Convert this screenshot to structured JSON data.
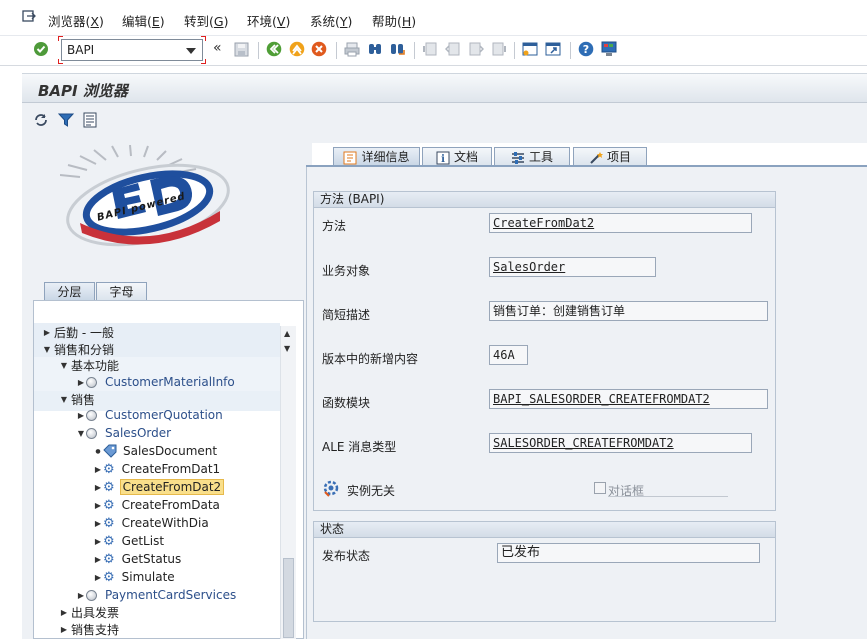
{
  "menu": {
    "items": [
      {
        "text": "浏览器(",
        "key": "X",
        "end": ")"
      },
      {
        "text": "编辑(",
        "key": "E",
        "end": ")"
      },
      {
        "text": "转到(",
        "key": "G",
        "end": ")"
      },
      {
        "text": "环境(",
        "key": "V",
        "end": ")"
      },
      {
        "text": "系统(",
        "key": "Y",
        "end": ")"
      },
      {
        "text": "帮助(",
        "key": "H",
        "end": ")"
      }
    ]
  },
  "toolbar": {
    "command_value": "BAPI",
    "collapse_symbol": "«"
  },
  "page": {
    "title": "BAPI 浏览器"
  },
  "logo": {
    "caption": "BAPI powered"
  },
  "left_tabs": [
    "分层",
    "字母"
  ],
  "tree": {
    "rows": [
      {
        "label": "后勤 - 一般"
      },
      {
        "label": "销售和分销"
      },
      {
        "label": "基本功能"
      },
      {
        "label": "CustomerMaterialInfo"
      },
      {
        "label": "销售"
      },
      {
        "label": "CustomerQuotation"
      },
      {
        "label": "SalesOrder"
      },
      {
        "label": "SalesDocument"
      },
      {
        "label": "CreateFromDat1"
      },
      {
        "label": "CreateFromDat2"
      },
      {
        "label": "CreateFromData"
      },
      {
        "label": "CreateWithDia"
      },
      {
        "label": "GetList"
      },
      {
        "label": "GetStatus"
      },
      {
        "label": "Simulate"
      },
      {
        "label": "PaymentCardServices"
      },
      {
        "label": "出具发票"
      },
      {
        "label": "销售支持"
      }
    ],
    "selected": "CreateFromDat2"
  },
  "right_tabs": [
    {
      "label": "详细信息",
      "icon": "detail-icon"
    },
    {
      "label": "文档",
      "icon": "info-icon"
    },
    {
      "label": "工具",
      "icon": "tools-icon"
    },
    {
      "label": "项目",
      "icon": "project-wand-icon"
    }
  ],
  "method_group": {
    "title": "方法 (BAPI)",
    "fields": [
      {
        "label": "方法",
        "value": "CreateFromDat2"
      },
      {
        "label": "业务对象",
        "value": "SalesOrder"
      },
      {
        "label": "简短描述",
        "value": "销售订单：创建销售订单"
      },
      {
        "label": "版本中的新增内容",
        "value": "46A"
      },
      {
        "label": "函数模块",
        "value": "BAPI_SALESORDER_CREATEFROMDAT2"
      },
      {
        "label": "ALE 消息类型",
        "value": "SALESORDER_CREATEFROMDAT2"
      }
    ],
    "instance_label": "实例无关",
    "dialog_label": "对话框"
  },
  "status_group": {
    "title": "状态",
    "release_label": "发布状态",
    "release_value": "已发布"
  }
}
